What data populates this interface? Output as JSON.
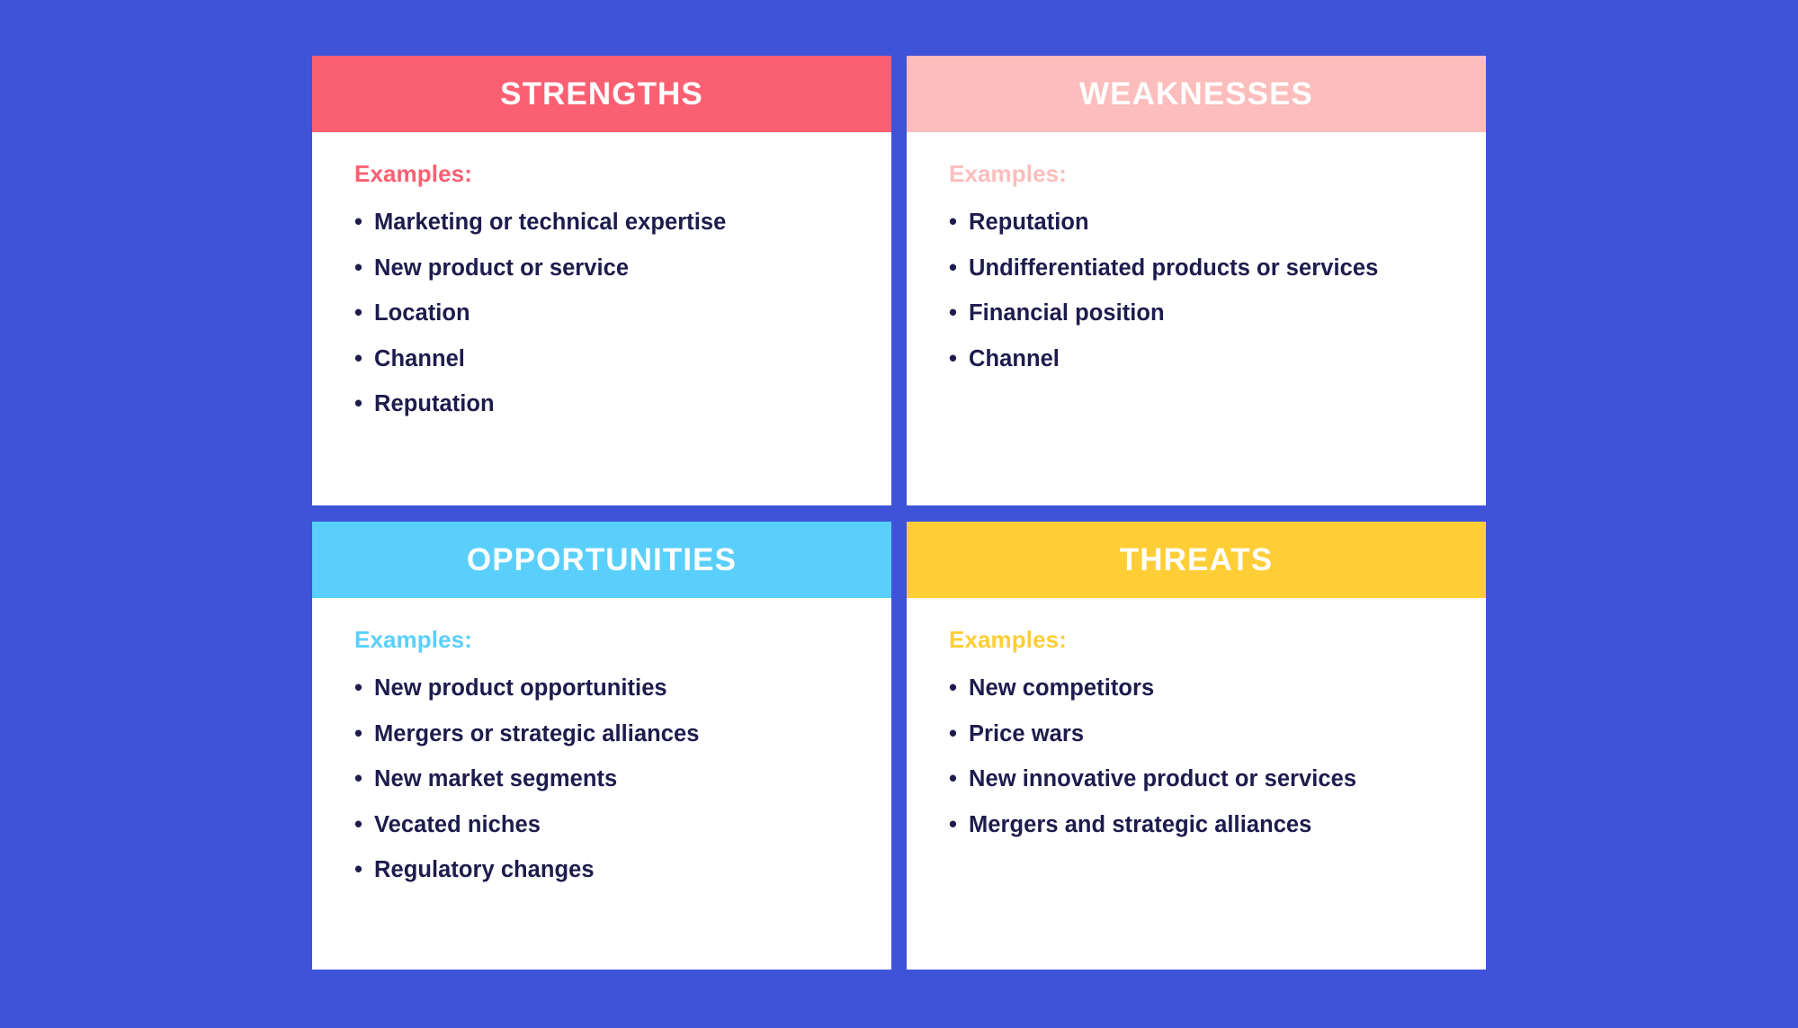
{
  "page": {
    "background_color": "#3F53D9",
    "body_text_color": "#1E1B4D",
    "header_text_color": "#FFFFFF",
    "card_background_color": "#FFFFFF"
  },
  "quadrants": [
    {
      "key": "strengths",
      "title": "STRENGTHS",
      "accent_color": "#FB6072",
      "examples_label": "Examples:",
      "items": [
        "Marketing or technical expertise",
        "New product or service",
        "Location",
        "Channel",
        "Reputation"
      ]
    },
    {
      "key": "weaknesses",
      "title": "WEAKNESSES",
      "accent_color": "#FCBDBD",
      "examples_label": "Examples:",
      "items": [
        "Reputation",
        "Undifferentiated products or services",
        "Financial position",
        "Channel"
      ]
    },
    {
      "key": "opportunities",
      "title": "OPPORTUNITIES",
      "accent_color": "#5BCFFB",
      "examples_label": "Examples:",
      "items": [
        "New product opportunities",
        "Mergers or strategic alliances",
        "New market segments",
        "Vecated niches",
        "Regulatory changes"
      ]
    },
    {
      "key": "threats",
      "title": "THREATS",
      "accent_color": "#FFCE36",
      "examples_label": "Examples:",
      "items": [
        "New competitors",
        "Price wars",
        "New innovative product or services",
        "Mergers and strategic alliances"
      ]
    }
  ]
}
